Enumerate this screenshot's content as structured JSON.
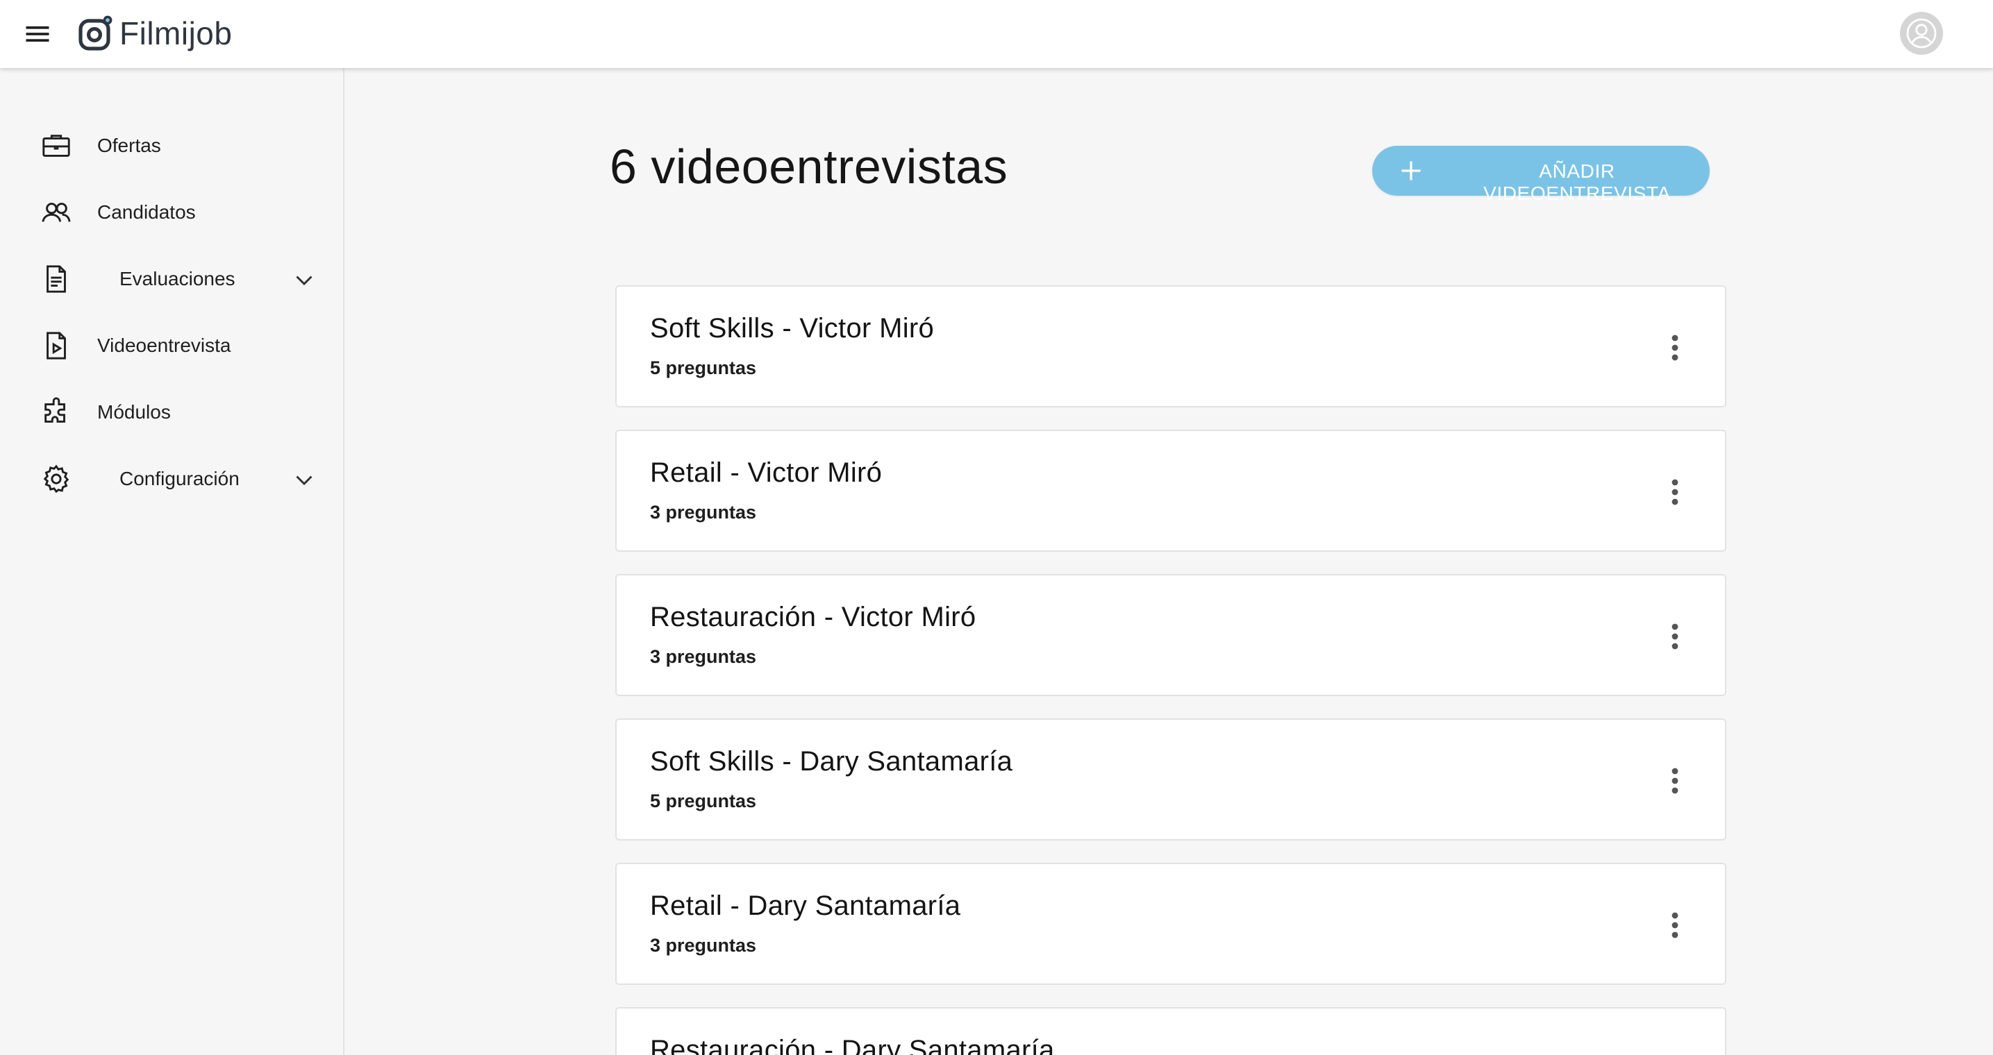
{
  "app": {
    "brand": "Filmijob",
    "accent_color": "#7bc3e6"
  },
  "topbar": {
    "menu_icon": "hamburger-menu-icon",
    "avatar_icon": "user-avatar-icon"
  },
  "sidebar": {
    "items": [
      {
        "label": "Ofertas",
        "icon": "briefcase-icon",
        "expandable": false
      },
      {
        "label": "Candidatos",
        "icon": "users-icon",
        "expandable": false
      },
      {
        "label": "Evaluaciones",
        "icon": "document-list-icon",
        "expandable": true
      },
      {
        "label": "Videoentrevista",
        "icon": "video-file-icon",
        "expandable": false
      },
      {
        "label": "Módulos",
        "icon": "puzzle-icon",
        "expandable": false
      },
      {
        "label": "Configuración",
        "icon": "gear-icon",
        "expandable": true
      }
    ]
  },
  "main": {
    "title": "6 videoentrevistas",
    "add_button_label": "AÑADIR VIDEOENTREVISTA",
    "interviews": [
      {
        "title": "Soft Skills - Victor Miró",
        "subtitle": "5 preguntas"
      },
      {
        "title": "Retail - Victor Miró",
        "subtitle": "3 preguntas"
      },
      {
        "title": "Restauración - Victor Miró",
        "subtitle": "3 preguntas"
      },
      {
        "title": "Soft Skills - Dary Santamaría",
        "subtitle": "5 preguntas"
      },
      {
        "title": "Retail - Dary Santamaría",
        "subtitle": "3 preguntas"
      },
      {
        "title": "Restauración - Dary Santamaría",
        "subtitle": ""
      }
    ]
  }
}
